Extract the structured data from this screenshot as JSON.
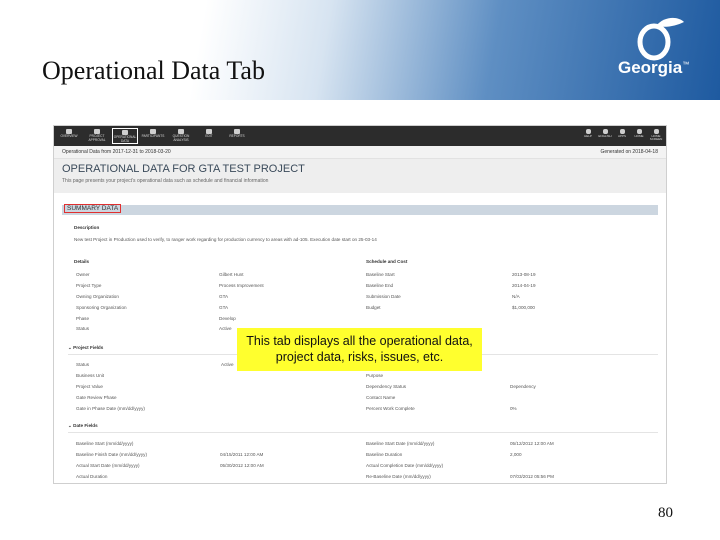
{
  "slide": {
    "title": "Operational Data Tab",
    "page_number": "80",
    "logo_text": "Georgia",
    "callout": "This tab displays all the operational data, project data, risks, issues, etc."
  },
  "nav": {
    "items": [
      {
        "name": "nav-overview",
        "label": "OVERVIEW"
      },
      {
        "name": "nav-project-approval",
        "label": "PROJECT APPROVAL"
      },
      {
        "name": "nav-operational-data",
        "label": "OPERATIONAL DATA",
        "active": true
      },
      {
        "name": "nav-participants",
        "label": "PARTICIPANTS"
      },
      {
        "name": "nav-question-analysis",
        "label": "QUESTION ANALYSIS"
      },
      {
        "name": "nav-edit",
        "label": "EDIT"
      },
      {
        "name": "nav-reports",
        "label": "REPORTS"
      }
    ],
    "right_items": [
      {
        "name": "nav-help",
        "label": "HELP"
      },
      {
        "name": "nav-english",
        "label": "ENGLISH"
      },
      {
        "name": "nav-apps",
        "label": "APPS"
      },
      {
        "name": "nav-home",
        "label": "HOME"
      },
      {
        "name": "nav-home-screen",
        "label": "HOME SCREEN"
      }
    ]
  },
  "screen": {
    "period": "Operational Data from 2017-12-31 to 2018-03-20",
    "generated": "Generated on 2018-04-18",
    "heading": "OPERATIONAL DATA FOR GTA TEST PROJECT",
    "description": "This page presents your project’s operational data such as schedule and financial information"
  },
  "summary": {
    "title": "SUMMARY DATA",
    "description_label": "Description",
    "description": "New test Project in Production used to verify, to ranger work regarding for production currency to areas with ad-105. Execution date start on 25-03-14",
    "details_label": "Details",
    "schedule_label": "Schedule and Cost",
    "details": [
      {
        "label": "Owner",
        "value": "Gilbert Hunt"
      },
      {
        "label": "Project Type",
        "value": "Process Improvement"
      },
      {
        "label": "Owning Organization",
        "value": "GTA"
      },
      {
        "label": "Sponsoring Organization",
        "value": "GTA"
      },
      {
        "label": "Phase",
        "value": "Develop"
      },
      {
        "label": "Status",
        "value": "Active"
      }
    ],
    "schedule": [
      {
        "label": "Baseline Start",
        "value": "2013-08-19"
      },
      {
        "label": "Baseline End",
        "value": "2014-04-19"
      },
      {
        "label": "Submission Date",
        "value": "N/A"
      },
      {
        "label": "Budget",
        "value": "$1,000,000"
      }
    ]
  },
  "project_fields": {
    "title": "Project Fields",
    "left": [
      {
        "label": "Status",
        "value": "Active"
      },
      {
        "label": "Business Unit",
        "value": ""
      },
      {
        "label": "Project Value",
        "value": ""
      },
      {
        "label": "Gate Review Phase",
        "value": ""
      },
      {
        "label": "Gate in Phase Date (mm/dd/yyyy)",
        "value": ""
      }
    ],
    "right": [
      {
        "label": "Health",
        "value": ""
      },
      {
        "label": "Purpose",
        "value": ""
      },
      {
        "label": "Dependency Status",
        "value": "Dependency"
      },
      {
        "label": "Contact Name",
        "value": ""
      },
      {
        "label": "Percent Work Complete",
        "value": "0%"
      }
    ]
  },
  "date_fields": {
    "title": "Date Fields",
    "left": [
      {
        "label": "Baseline Start (mm/dd/yyyy)",
        "value": ""
      },
      {
        "label": "Baseline Finish Date (mm/dd/yyyy)",
        "value": "04/15/2011 12:00 AM"
      },
      {
        "label": "Actual Start Date (mm/dd/yyyy)",
        "value": "05/30/2012 12:00 AM"
      },
      {
        "label": "Actual Duration",
        "value": ""
      }
    ],
    "right": [
      {
        "label": "Baseline Start Date (mm/dd/yyyy)",
        "value": "05/12/2012 12:00 AM"
      },
      {
        "label": "Baseline Duration",
        "value": "2,000"
      },
      {
        "label": "Actual Completion Date (mm/dd/yyyy)",
        "value": ""
      },
      {
        "label": "Re-Baseline Date (mm/dd/yyyy)",
        "value": "07/03/2012 05:56 PM"
      }
    ]
  }
}
